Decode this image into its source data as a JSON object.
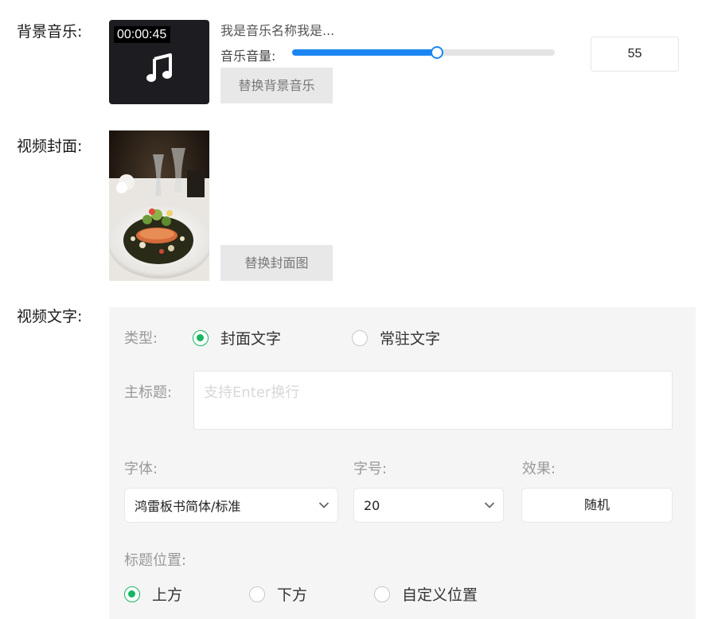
{
  "music": {
    "section_label": "背景音乐:",
    "duration": "00:00:45",
    "icon": "music-note-icon",
    "title": "我是音乐名称我是...",
    "volume_label": "音乐音量:",
    "volume_value": "55",
    "volume_percent": 55,
    "replace_button": "替换背景音乐",
    "slider_color": "#1b86f2"
  },
  "cover": {
    "section_label": "视频封面:",
    "image_alt": "plated salmon dish",
    "replace_button": "替换封面图"
  },
  "text": {
    "section_label": "视频文字:",
    "type_label": "类型:",
    "type_options": [
      {
        "label": "封面文字",
        "selected": true
      },
      {
        "label": "常驻文字",
        "selected": false
      }
    ],
    "title_label": "主标题:",
    "title_placeholder": "支持Enter换行",
    "font_label": "字体:",
    "font_value": "鸿雷板书简体/标准",
    "size_label": "字号:",
    "size_value": "20",
    "effect_label": "效果:",
    "effect_value": "随机",
    "position_label": "标题位置:",
    "position_options": [
      {
        "label": "上方",
        "selected": true
      },
      {
        "label": "下方",
        "selected": false
      },
      {
        "label": "自定义位置",
        "selected": false
      }
    ],
    "accent_color": "#16b661"
  }
}
